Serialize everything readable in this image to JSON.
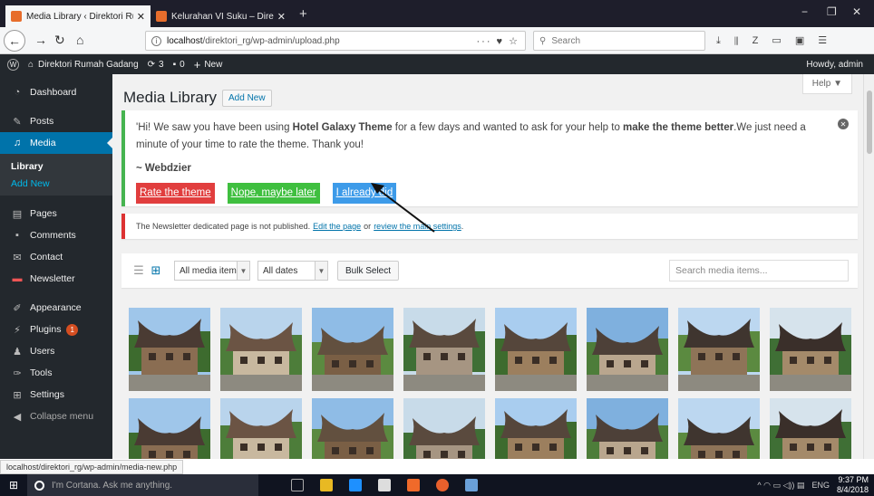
{
  "browser": {
    "tabs": [
      {
        "title": "Media Library ‹ Direktori Rumah",
        "close": "✕"
      },
      {
        "title": "Kelurahan VI Suku – Direktori R",
        "close": "✕"
      }
    ],
    "new_tab": "+",
    "url_host": "localhost",
    "url_path": "/direktori_rg/wp-admin/upload.php",
    "url_actions": "··· ♥ ☆",
    "search_placeholder": "Search",
    "win_min": "−",
    "win_max": "❐",
    "win_close": "✕"
  },
  "adminbar": {
    "site_name": "Direktori Rumah Gadang",
    "updates_count": "3",
    "comments_count": "0",
    "new_label": "New",
    "howdy": "Howdy, admin"
  },
  "sidebar": {
    "dashboard": "Dashboard",
    "posts": "Posts",
    "media": "Media",
    "library": "Library",
    "add_new": "Add New",
    "pages": "Pages",
    "comments": "Comments",
    "contact": "Contact",
    "newsletter": "Newsletter",
    "appearance": "Appearance",
    "plugins": "Plugins",
    "plugins_badge": "1",
    "users": "Users",
    "tools": "Tools",
    "settings": "Settings",
    "collapse": "Collapse menu"
  },
  "main": {
    "help": "Help ▼",
    "title": "Media Library",
    "add_new": "Add New",
    "notice": {
      "text_a": "'Hi! We saw you have been using ",
      "theme": "Hotel Galaxy Theme",
      "text_b": " for a few days and wanted to ask for your help to ",
      "strong": "make the theme better",
      "text_c": ".We just need a minute of your time to rate the theme. Thank you!",
      "signature": "~ Webdzier",
      "btn_rate": "Rate the theme",
      "btn_later": "Nope, maybe later",
      "btn_done": "I already did",
      "dismiss": "✕"
    },
    "newsletter_notice": {
      "text": "The Newsletter dedicated page is not published.",
      "edit_link": "Edit the page",
      "or": "or",
      "review_link": "review the main settings",
      "end": "."
    },
    "toolbar": {
      "filter_type": "All media items",
      "filter_date": "All dates",
      "bulk_select": "Bulk Select",
      "search_placeholder": "Search media items..."
    }
  },
  "status_url": "localhost/direktori_rg/wp-admin/media-new.php",
  "taskbar": {
    "cortana": "I'm Cortana. Ask me anything.",
    "lang": "ENG",
    "time": "9:37 PM",
    "date": "8/4/2018"
  },
  "colors": {
    "admin_dark": "#23282d",
    "wp_blue": "#0073aa",
    "notice_green": "#46b450",
    "notice_red": "#dc3232"
  }
}
